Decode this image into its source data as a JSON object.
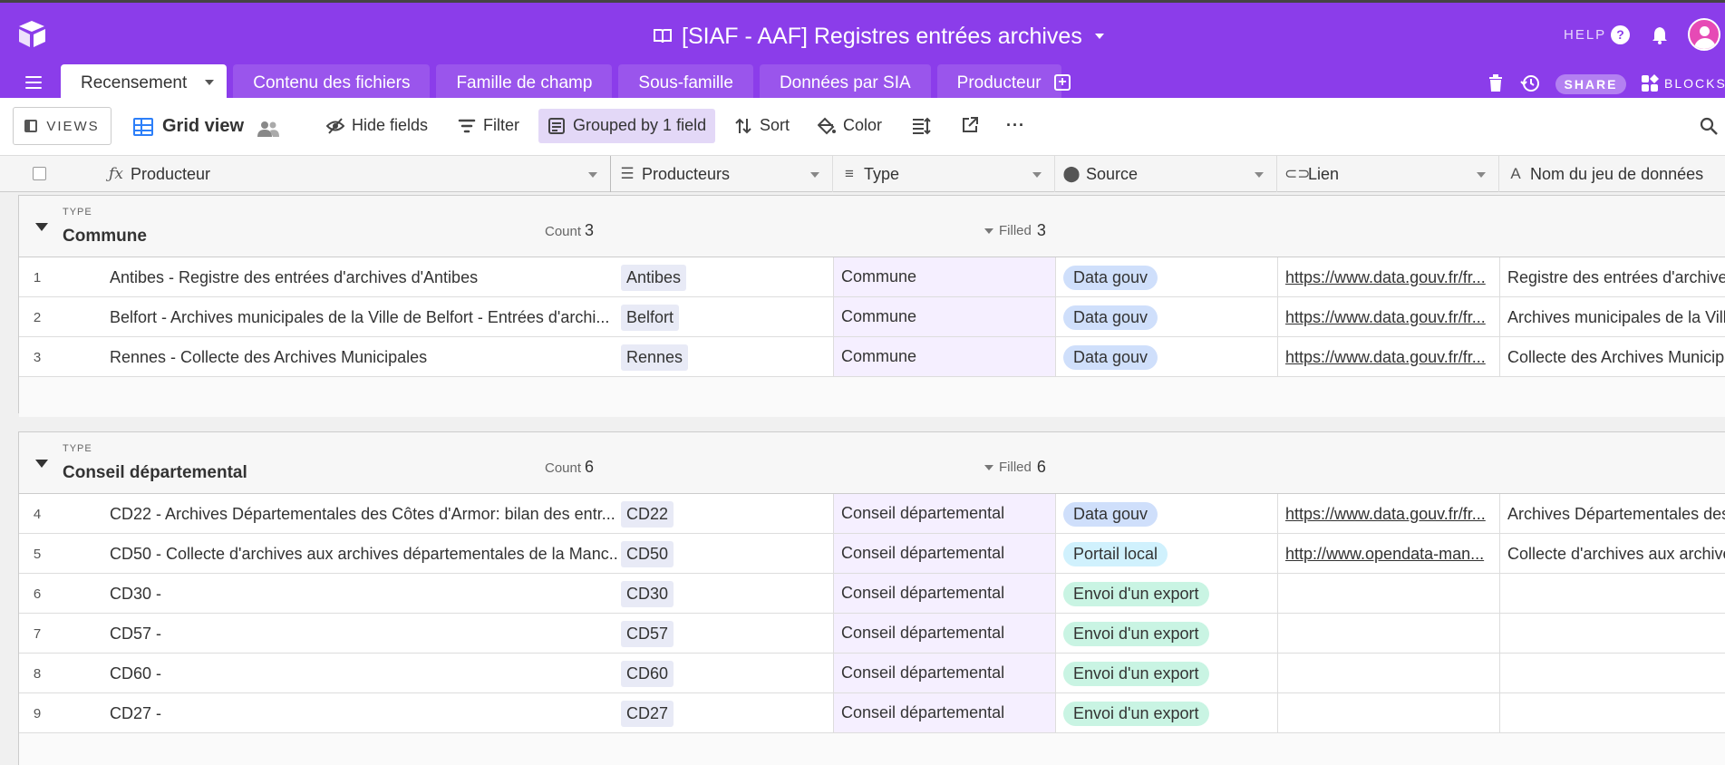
{
  "base": {
    "title": "[SIAF - AAF] Registres entrées archives",
    "help_label": "HELP",
    "help_glyph": "?",
    "share_label": "SHARE",
    "blocks_label": "BLOCKS",
    "add_tab_glyph": "+"
  },
  "tabs": [
    {
      "label": "Recensement",
      "active": true
    },
    {
      "label": "Contenu des fichiers"
    },
    {
      "label": "Famille de champ"
    },
    {
      "label": "Sous-famille"
    },
    {
      "label": "Données par SIA"
    },
    {
      "label": "Producteur"
    }
  ],
  "toolbar": {
    "views_label": "VIEWS",
    "view_name": "Grid view",
    "hide_fields": "Hide fields",
    "filter": "Filter",
    "grouped": "Grouped by 1 field",
    "sort": "Sort",
    "color": "Color",
    "more": "···"
  },
  "columns": {
    "producteur": "Producteur",
    "producteurs": "Producteurs",
    "type": "Type",
    "source": "Source",
    "lien": "Lien",
    "nom": "Nom du jeu de données"
  },
  "colors": {
    "header_purple": "#8b3dea",
    "data_gouv": "#cfdffb",
    "portail_local": "#d0f1fd",
    "envoi_export": "#c9f4e3",
    "type_cell_bg": "#f5efff"
  },
  "groups": [
    {
      "type_label": "TYPE",
      "name": "Commune",
      "count_label": "Count",
      "count": "3",
      "filled_label": "Filled",
      "filled": "3",
      "rows": [
        {
          "num": "1",
          "producteur": "Antibes - Registre des entrées d'archives d'Antibes",
          "producteurs": "Antibes",
          "type": "Commune",
          "source": "Data gouv",
          "lien": "https://www.data.gouv.fr/fr...",
          "nom": "Registre des entrées d'archives"
        },
        {
          "num": "2",
          "producteur": "Belfort - Archives municipales de la Ville de Belfort - Entrées d'archi...",
          "producteurs": "Belfort",
          "type": "Commune",
          "source": "Data gouv",
          "lien": "https://www.data.gouv.fr/fr...",
          "nom": "Archives municipales de la Ville"
        },
        {
          "num": "3",
          "producteur": "Rennes - Collecte des Archives Municipales",
          "producteurs": "Rennes",
          "type": "Commune",
          "source": "Data gouv",
          "lien": "https://www.data.gouv.fr/fr...",
          "nom": "Collecte des Archives Municipa"
        }
      ]
    },
    {
      "type_label": "TYPE",
      "name": "Conseil départemental",
      "count_label": "Count",
      "count": "6",
      "filled_label": "Filled",
      "filled": "6",
      "rows": [
        {
          "num": "4",
          "producteur": "CD22 - Archives Départementales des Côtes d'Armor: bilan des entr...",
          "producteurs": "CD22",
          "type": "Conseil départemental",
          "source": "Data gouv",
          "lien": "https://www.data.gouv.fr/fr...",
          "nom": "Archives Départementales des"
        },
        {
          "num": "5",
          "producteur": "CD50 - Collecte d'archives aux archives départementales de la Manc...",
          "producteurs": "CD50",
          "type": "Conseil départemental",
          "source": "Portail local",
          "lien": "http://www.opendata-man...",
          "nom": "Collecte d'archives aux archives"
        },
        {
          "num": "6",
          "producteur": "CD30 -",
          "producteurs": "CD30",
          "type": "Conseil départemental",
          "source": "Envoi d'un export",
          "lien": "",
          "nom": ""
        },
        {
          "num": "7",
          "producteur": "CD57 -",
          "producteurs": "CD57",
          "type": "Conseil départemental",
          "source": "Envoi d'un export",
          "lien": "",
          "nom": ""
        },
        {
          "num": "8",
          "producteur": "CD60 -",
          "producteurs": "CD60",
          "type": "Conseil départemental",
          "source": "Envoi d'un export",
          "lien": "",
          "nom": ""
        },
        {
          "num": "9",
          "producteur": "CD27 -",
          "producteurs": "CD27",
          "type": "Conseil départemental",
          "source": "Envoi d'un export",
          "lien": "",
          "nom": ""
        }
      ]
    }
  ]
}
